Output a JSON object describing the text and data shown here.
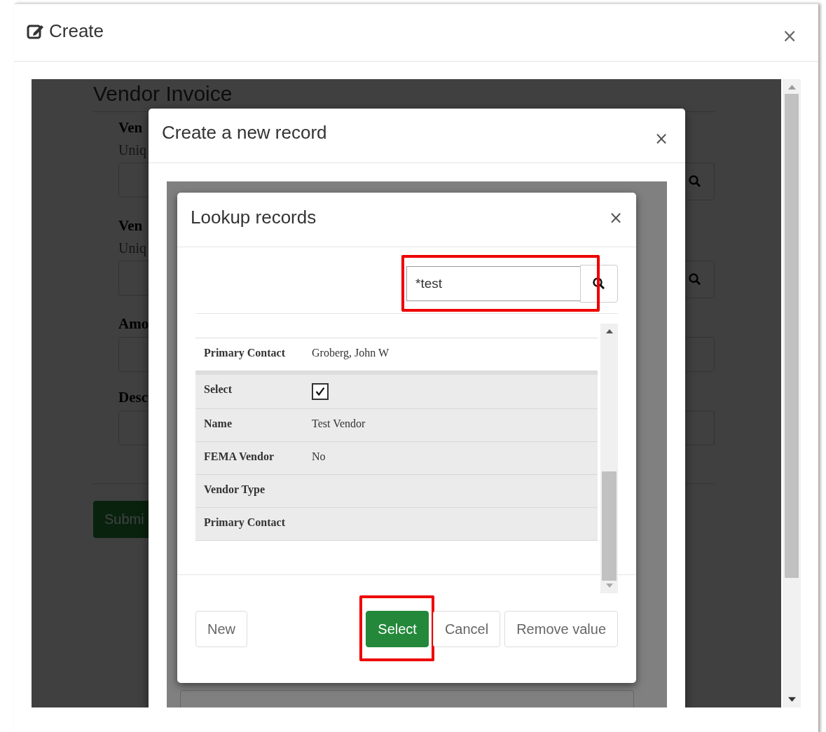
{
  "window": {
    "title": "Create",
    "close": "×"
  },
  "background_form": {
    "title": "Vendor Invoice",
    "fields": [
      {
        "kind": "lookup",
        "label": "Ven",
        "hint": "Uniq"
      },
      {
        "kind": "lookup",
        "label": "Ven",
        "hint": "Uniq"
      },
      {
        "kind": "text",
        "label": "Amo"
      },
      {
        "kind": "text",
        "label": "Desc"
      }
    ],
    "submit": "Submi"
  },
  "create_dialog": {
    "title": "Create a new record",
    "close": "×"
  },
  "lookup_dialog": {
    "title": "Lookup records",
    "close": "×",
    "search": {
      "value": "*test",
      "highlighted": true
    },
    "records": [
      {
        "selected": false,
        "fields": [
          {
            "kind": "text",
            "label": "Primary Contact",
            "value": "Groberg, John W"
          }
        ]
      },
      {
        "selected": true,
        "fields": [
          {
            "kind": "checkbox",
            "label": "Select",
            "checked": true
          },
          {
            "kind": "text",
            "label": "Name",
            "value": "Test Vendor"
          },
          {
            "kind": "text",
            "label": "FEMA Vendor",
            "value": "No"
          },
          {
            "kind": "text",
            "label": "Vendor Type"
          },
          {
            "kind": "text",
            "label": "Primary Contact"
          }
        ]
      }
    ],
    "buttons": [
      {
        "kind": "default",
        "label": "New",
        "highlighted": false
      },
      {
        "kind": "primary",
        "label": "Select",
        "highlighted": true
      },
      {
        "kind": "default",
        "label": "Cancel",
        "highlighted": false
      },
      {
        "kind": "default",
        "label": "Remove value",
        "highlighted": false
      }
    ]
  }
}
